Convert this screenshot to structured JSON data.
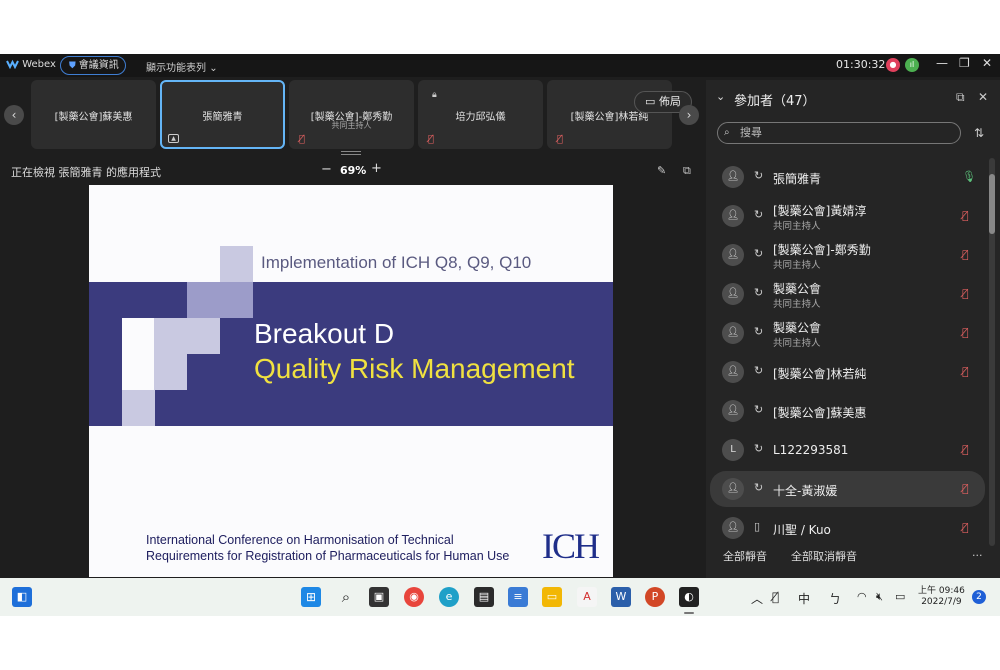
{
  "titlebar": {
    "app_name": "Webex",
    "meeting_info": "會議資訊",
    "feature_menu": "顯示功能表列",
    "time": "01:30:32",
    "icons": [
      "webex-logo-icon",
      "shield-icon",
      "chevron-down-icon",
      "recording-icon",
      "network-icon",
      "minimize-icon",
      "restore-icon",
      "close-icon"
    ]
  },
  "tiles": [
    {
      "name": "[製藥公會]蘇美惠",
      "role": "",
      "muted": false
    },
    {
      "name": "張簡雅青",
      "role": "",
      "muted": false
    },
    {
      "name": "[製藥公會]-鄭秀勤",
      "role": "共同主持人",
      "muted": true
    },
    {
      "name": "培力邱弘儀",
      "role": "",
      "muted": true
    },
    {
      "name": "[製藥公會]林若純",
      "role": "",
      "muted": true
    }
  ],
  "layout_button": "佈局",
  "share_view": {
    "viewing_text": "正在檢視 張簡雅青 的應用程式",
    "zoom_minus": "−",
    "zoom_level": "69%",
    "zoom_plus": "+"
  },
  "slide": {
    "subtitle": "Implementation of ICH Q8, Q9, Q10",
    "title_line1": "Breakout D",
    "title_line2": "Quality Risk Management",
    "footer_line1": "International Conference on Harmonisation of Technical",
    "footer_line2": "Requirements for Registration of Pharmaceuticals for Human Use",
    "logo_text": "ICH",
    "colors": {
      "band": "#3b3b7e",
      "title": "#ffffff",
      "highlight": "#f0e140"
    }
  },
  "panel": {
    "title": "參加者（47）",
    "search_placeholder": "搜尋",
    "participants": [
      {
        "name": "張簡雅青",
        "role": "",
        "avatar": "",
        "mic": "on"
      },
      {
        "name": "[製藥公會]黃婧淳",
        "role": "共同主持人",
        "avatar": "",
        "mic": "off"
      },
      {
        "name": "[製藥公會]-鄭秀勤",
        "role": "共同主持人",
        "avatar": "",
        "mic": "off"
      },
      {
        "name": "製藥公會",
        "role": "共同主持人",
        "avatar": "",
        "mic": "off"
      },
      {
        "name": "製藥公會",
        "role": "共同主持人",
        "avatar": "",
        "mic": "off"
      },
      {
        "name": "[製藥公會]林若純",
        "role": "",
        "avatar": "",
        "mic": "off"
      },
      {
        "name": "[製藥公會]蘇美惠",
        "role": "",
        "avatar": "",
        "mic": "none"
      },
      {
        "name": "L122293581",
        "role": "",
        "avatar": "L",
        "mic": "off"
      },
      {
        "name": "十全-黃淑媛",
        "role": "",
        "avatar": "",
        "mic": "off"
      },
      {
        "name": "川聖 / Kuo",
        "role": "",
        "avatar": "",
        "mic": "off"
      }
    ],
    "mute_all": "全部靜音",
    "unmute_all": "全部取消靜音",
    "more": "..."
  },
  "taskbar": {
    "ime": "中",
    "ime2": "ㄅ",
    "time": "上午 09:46",
    "date": "2022/7/9",
    "notification_count": "2",
    "icons": [
      "widgets-icon",
      "start-icon",
      "search-icon",
      "taskview-icon",
      "chrome-icon",
      "edge-icon",
      "sticky-notes-icon",
      "notepad-icon",
      "file-explorer-icon",
      "acrobat-icon",
      "word-icon",
      "powerpoint-icon",
      "webex-icon",
      "chevron-up-icon",
      "mic-muted-icon",
      "wifi-icon",
      "volume-icon",
      "battery-icon"
    ]
  }
}
